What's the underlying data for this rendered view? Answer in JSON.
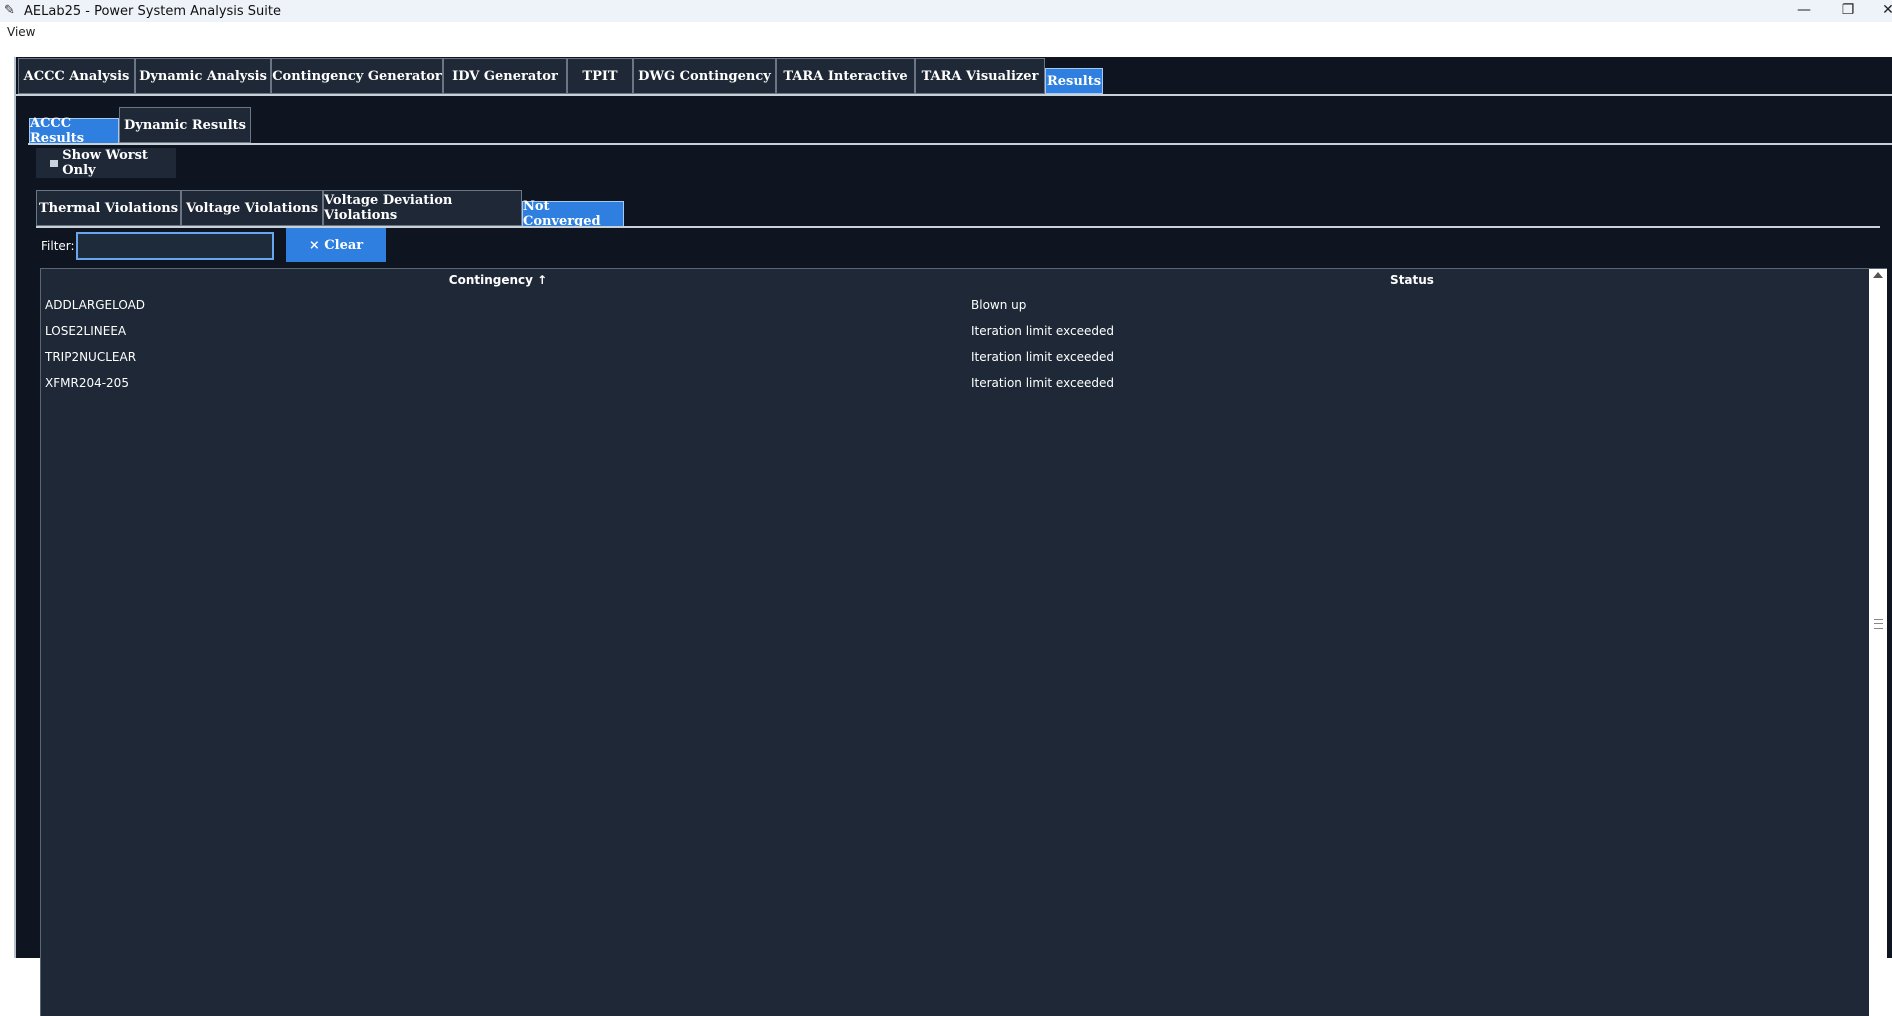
{
  "window": {
    "title": "AELab25 - Power System Analysis Suite",
    "minimize_glyph": "—",
    "restore_glyph": "❐",
    "close_glyph": "✕"
  },
  "menu": {
    "view_label": "View"
  },
  "main_tabs": [
    {
      "label": "ACCC Analysis"
    },
    {
      "label": "Dynamic Analysis"
    },
    {
      "label": "Contingency Generator"
    },
    {
      "label": "IDV Generator"
    },
    {
      "label": "TPIT"
    },
    {
      "label": "DWG Contingency"
    },
    {
      "label": "TARA Interactive"
    },
    {
      "label": "TARA Visualizer"
    },
    {
      "label": "Results",
      "selected": true
    }
  ],
  "results_tabs": [
    {
      "label": "ACCC Results",
      "selected": true
    },
    {
      "label": "Dynamic Results"
    }
  ],
  "show_worst_label": "Show Worst Only",
  "violation_tabs": [
    {
      "label": "Thermal Violations"
    },
    {
      "label": "Voltage Violations"
    },
    {
      "label": "Voltage Deviation Violations"
    },
    {
      "label": "Not Converged",
      "selected": true
    }
  ],
  "filter": {
    "label": "Filter:",
    "value": "",
    "clear_label": "× Clear"
  },
  "table": {
    "columns": [
      {
        "label": "Contingency ↑"
      },
      {
        "label": "Status"
      }
    ],
    "rows": [
      {
        "contingency": "ADDLARGELOAD",
        "status": "Blown up"
      },
      {
        "contingency": "LOSE2LINEEA",
        "status": "Iteration limit exceeded"
      },
      {
        "contingency": "TRIP2NUCLEAR",
        "status": "Iteration limit exceeded"
      },
      {
        "contingency": "XFMR204-205",
        "status": "Iteration limit exceeded"
      }
    ]
  },
  "colors": {
    "selected_tab": "#2f7fe0",
    "background": "#0e1520",
    "tab": "#1e2836"
  }
}
